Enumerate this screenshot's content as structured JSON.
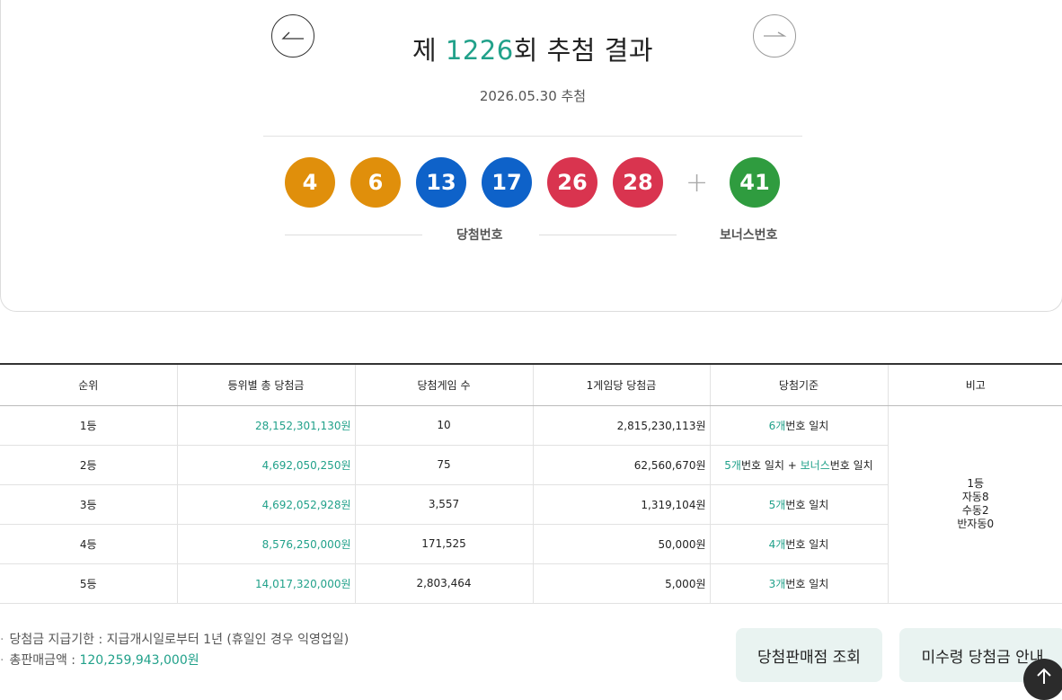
{
  "header": {
    "title_prefix": "제 ",
    "draw_number": "1226",
    "title_suffix": "회 추첨 결과",
    "date": "2026.05.30 추첨"
  },
  "colors": {
    "accent": "#21a18a",
    "ball_yellow": "#e08f0b",
    "ball_blue": "#0e62c9",
    "ball_red": "#d9344f",
    "ball_green": "#2f9c3f"
  },
  "winning_numbers": [
    {
      "value": "4",
      "color": "#e08f0b"
    },
    {
      "value": "6",
      "color": "#e08f0b"
    },
    {
      "value": "13",
      "color": "#0e62c9"
    },
    {
      "value": "17",
      "color": "#0e62c9"
    },
    {
      "value": "26",
      "color": "#d9344f"
    },
    {
      "value": "28",
      "color": "#d9344f"
    }
  ],
  "plus_sign": "+",
  "bonus_number": {
    "value": "41",
    "color": "#2f9c3f"
  },
  "labels": {
    "winning": "당첨번호",
    "bonus": "보너스번호"
  },
  "icons": {
    "prev": "arrow-left-icon",
    "next": "arrow-right-icon",
    "scroll_top": "arrow-up-icon"
  },
  "table": {
    "headers": [
      "순위",
      "등위별 총 당첨금",
      "당첨게임 수",
      "1게임당 당첨금",
      "당첨기준",
      "비고"
    ],
    "rows": [
      {
        "rank": "1등",
        "total": "28,152,301,130원",
        "count": "10",
        "per_game": "2,815,230,113원",
        "criteria_num": "6개",
        "criteria_text": "번호 일치",
        "bonus_num": "",
        "bonus_text": ""
      },
      {
        "rank": "2등",
        "total": "4,692,050,250원",
        "count": "75",
        "per_game": "62,560,670원",
        "criteria_num": "5개",
        "criteria_text": "번호 일치 + ",
        "bonus_num": "보너스",
        "bonus_text": "번호 일치"
      },
      {
        "rank": "3등",
        "total": "4,692,052,928원",
        "count": "3,557",
        "per_game": "1,319,104원",
        "criteria_num": "5개",
        "criteria_text": "번호 일치",
        "bonus_num": "",
        "bonus_text": ""
      },
      {
        "rank": "4등",
        "total": "8,576,250,000원",
        "count": "171,525",
        "per_game": "50,000원",
        "criteria_num": "4개",
        "criteria_text": "번호 일치",
        "bonus_num": "",
        "bonus_text": ""
      },
      {
        "rank": "5등",
        "total": "14,017,320,000원",
        "count": "2,803,464",
        "per_game": "5,000원",
        "criteria_num": "3개",
        "criteria_text": "번호 일치",
        "bonus_num": "",
        "bonus_text": ""
      }
    ],
    "note_lines": [
      "1등",
      "자동8",
      "수동2",
      "반자동0"
    ]
  },
  "footer": {
    "deadline": "당첨금 지급기한 : 지급개시일로부터 1년 (휴일인 경우 익영업일)",
    "total_label": "총판매금액 : ",
    "total_value": "120,259,943,000원",
    "bullet": "·"
  },
  "buttons": {
    "store_lookup": "당첨판매점 조회",
    "unclaimed": "미수령 당첨금 안내"
  }
}
